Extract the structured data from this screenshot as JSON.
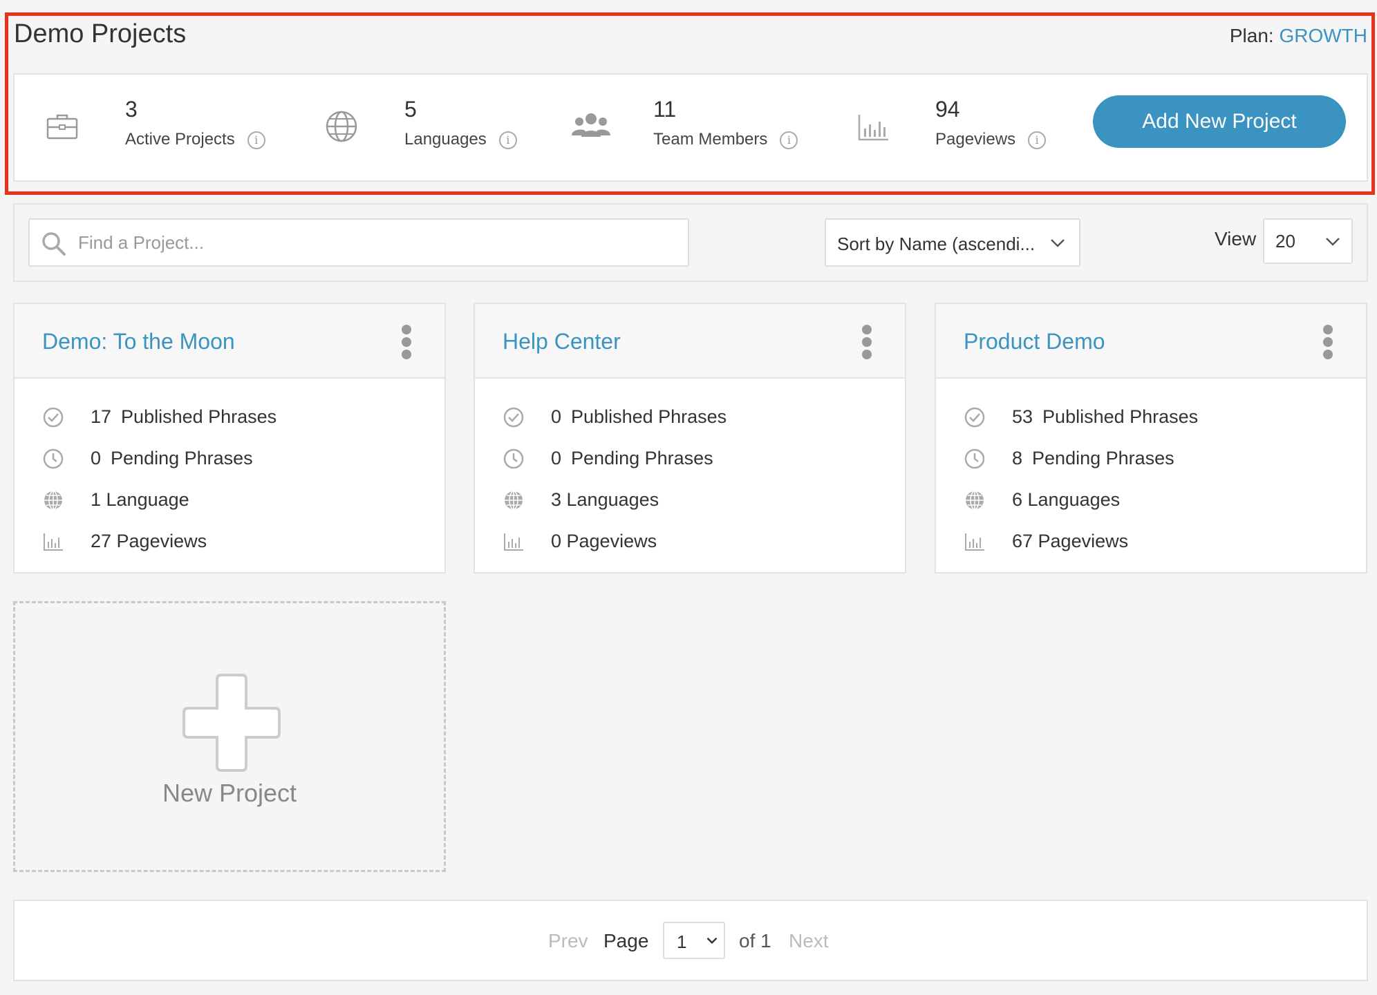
{
  "header": {
    "title": "Demo Projects",
    "plan_label": "Plan:",
    "plan_name": "GROWTH"
  },
  "stats": {
    "active_projects": {
      "value": "3",
      "label": "Active Projects",
      "icon": "briefcase-icon"
    },
    "languages": {
      "value": "5",
      "label": "Languages",
      "icon": "globe-icon"
    },
    "team_members": {
      "value": "11",
      "label": "Team Members",
      "icon": "users-icon"
    },
    "pageviews": {
      "value": "94",
      "label": "Pageviews",
      "icon": "bar-chart-icon"
    },
    "info_glyph": "i",
    "add_button_label": "Add New Project"
  },
  "filters": {
    "search_placeholder": "Find a Project...",
    "sort_value": "Sort by Name (ascendi...",
    "view_label": "View",
    "view_value": "20"
  },
  "projects": [
    {
      "title": "Demo: To the Moon",
      "published_count": "17",
      "published_label": "Published Phrases",
      "pending_count": "0",
      "pending_label": "Pending Phrases",
      "languages": "1 Language",
      "pageviews": "27 Pageviews"
    },
    {
      "title": "Help Center",
      "published_count": "0",
      "published_label": "Published Phrases",
      "pending_count": "0",
      "pending_label": "Pending Phrases",
      "languages": "3 Languages",
      "pageviews": "0 Pageviews"
    },
    {
      "title": "Product Demo",
      "published_count": "53",
      "published_label": "Published Phrases",
      "pending_count": "8",
      "pending_label": "Pending Phrases",
      "languages": "6 Languages",
      "pageviews": "67 Pageviews"
    }
  ],
  "new_project": {
    "label": "New Project"
  },
  "pagination": {
    "prev": "Prev",
    "page_label": "Page",
    "page_value": "1",
    "of_label": "of 1",
    "next": "Next"
  },
  "colors": {
    "accent": "#3a93c0",
    "highlight": "#e8321c"
  }
}
